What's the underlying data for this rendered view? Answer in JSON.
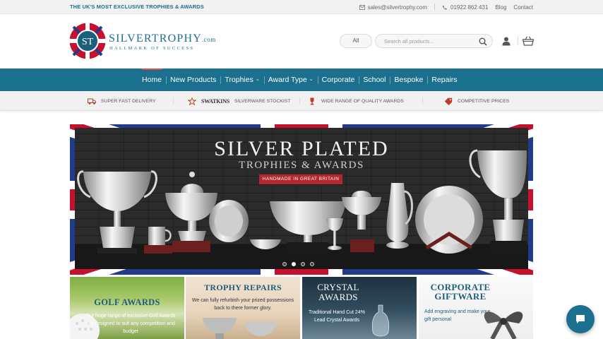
{
  "topbar": {
    "tagline": "THE UK'S MOST EXCLUSIVE TROPHIES & AWARDS",
    "email": "sales@silvertrophy.com",
    "phone": "01922 862 431",
    "blog": "Blog",
    "contact": "Contact"
  },
  "logo": {
    "monogram": "ST",
    "brand": "SILVERTROPHY",
    "brand_suffix": ".com",
    "tagline": "HALLMARK OF SUCCESS"
  },
  "search": {
    "category": "All",
    "placeholder": "Search all products..."
  },
  "nav": {
    "items": [
      {
        "label": "Home"
      },
      {
        "label": "New Products"
      },
      {
        "label": "Trophies"
      },
      {
        "label": "Award Type"
      },
      {
        "label": "Corporate"
      },
      {
        "label": "School"
      },
      {
        "label": "Bespoke"
      },
      {
        "label": "Repairs"
      }
    ]
  },
  "usp": {
    "delivery": "SUPER FAST DELIVERY",
    "swatkins_logo": "SWATKINS",
    "stockist": "SILVERWARE STOCKIST",
    "range": "WIDE RANGE OF QUALITY AWARDS",
    "prices": "COMPETITIVE PRICES"
  },
  "hero": {
    "title": "SILVER PLATED",
    "subtitle": "TROPHIES & AWARDS",
    "ribbon": "HANDMADE IN GREAT BRITAIN",
    "slides": 4,
    "active_slide": 2
  },
  "cards": {
    "golf": {
      "title": "GOLF AWARDS",
      "text": "Our huge range of exclusive Golf Awards are designed to suit any competition and budget"
    },
    "repairs": {
      "title": "TROPHY REPAIRS",
      "text": "We can fully refurbish your prized possessions back to there former glory."
    },
    "crystal": {
      "title1": "CRYSTAL",
      "title2": "AWARDS",
      "text": "Traditional Hand Cut 24% Lead Crystal Awards"
    },
    "corporate": {
      "title1": "CORPORATE",
      "title2": "GIFTWARE",
      "text": "Add engraving and make your gift personal"
    }
  },
  "colors": {
    "primary": "#1b6f8f",
    "accent": "#e74c3c"
  }
}
